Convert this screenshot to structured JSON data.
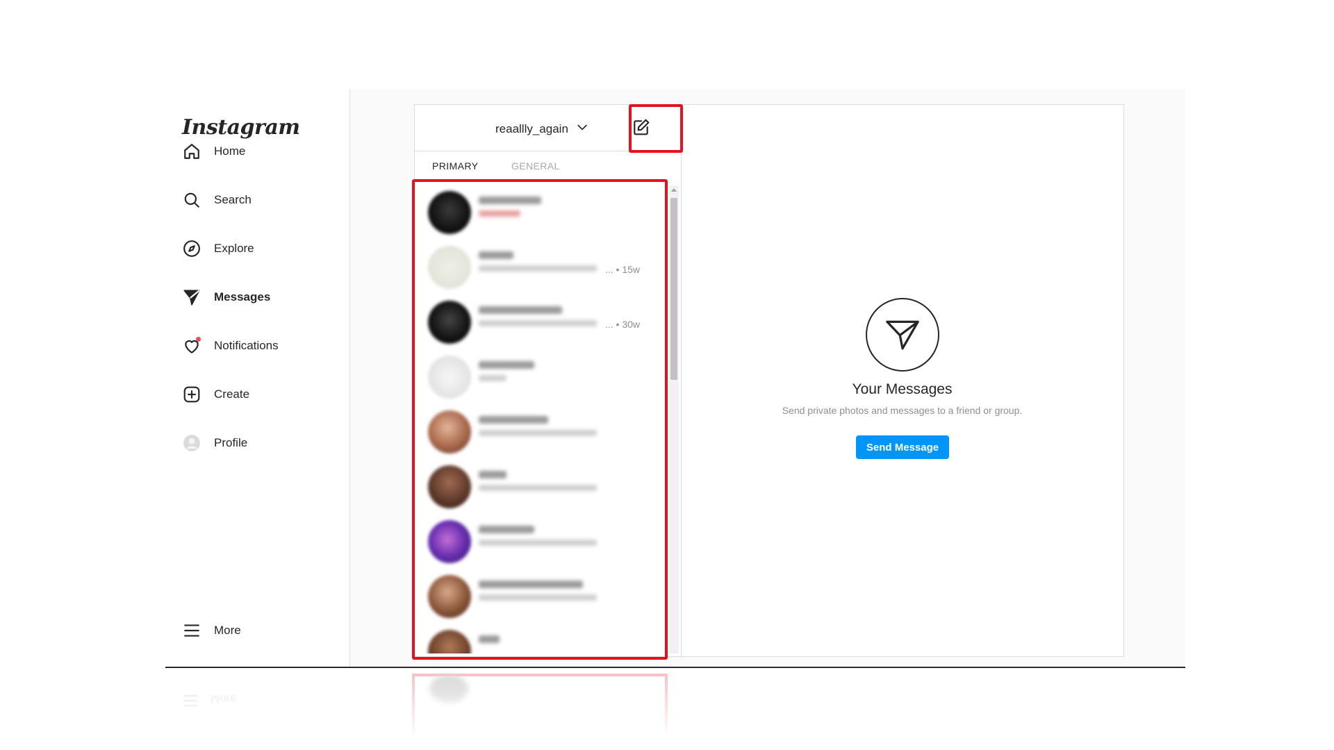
{
  "app": {
    "logo_text": "Instagram"
  },
  "sidebar": {
    "items": [
      {
        "label": "Home",
        "icon": "home-icon"
      },
      {
        "label": "Search",
        "icon": "search-icon"
      },
      {
        "label": "Explore",
        "icon": "compass-icon"
      },
      {
        "label": "Messages",
        "icon": "paper-plane-icon",
        "active": true
      },
      {
        "label": "Notifications",
        "icon": "heart-icon",
        "has_badge": true
      },
      {
        "label": "Create",
        "icon": "plus-square-icon"
      },
      {
        "label": "Profile",
        "icon": "avatar-icon"
      }
    ],
    "more_label": "More"
  },
  "inbox": {
    "account_name": "reaallly_again",
    "tabs": {
      "primary": "PRIMARY",
      "general": "GENERAL"
    },
    "threads": [
      {
        "time": ""
      },
      {
        "time": "... • 15w"
      },
      {
        "time": "... • 30w"
      },
      {
        "time": ""
      },
      {
        "time": ""
      },
      {
        "time": ""
      },
      {
        "time": ""
      },
      {
        "time": ""
      },
      {
        "time": ""
      }
    ]
  },
  "empty_state": {
    "title": "Your Messages",
    "subtitle": "Send private photos and messages to a friend or group.",
    "button_label": "Send Message"
  },
  "colors": {
    "accent": "#0095f6",
    "highlight": "#e8101c",
    "badge": "#ed4956"
  }
}
